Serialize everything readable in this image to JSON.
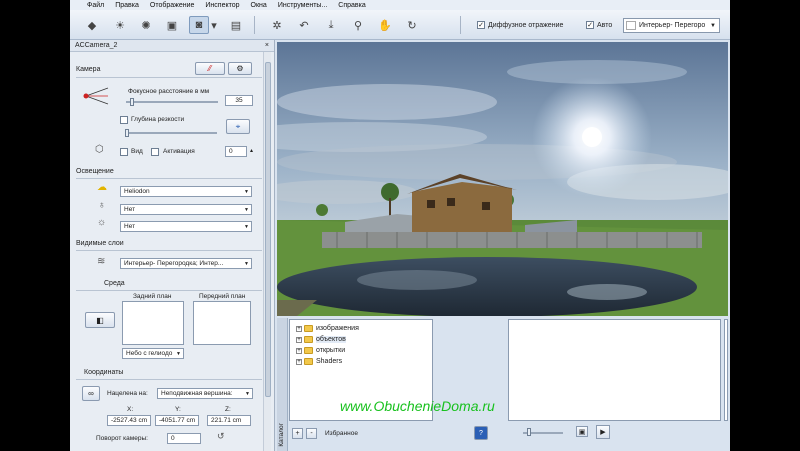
{
  "menu": [
    "Файл",
    "Правка",
    "Отображение",
    "Инспектор",
    "Окна",
    "Инструменты...",
    "Справка"
  ],
  "toolbar": {
    "diffuse_label": "Диффузное отражение",
    "diffuse_checked": "✓",
    "auto_label": "Авто",
    "auto_checked": "✓",
    "preset_value": "Интерьер- Перегоро"
  },
  "panel": {
    "title": "ACCamera_2",
    "close": "×",
    "camera": {
      "heading": "Камера",
      "focal_label": "Фокусное расстояние в мм",
      "focal_value": "35",
      "dof_label": "Глубина резкости",
      "view_label": "Вид",
      "activation_label": "Активация",
      "activation_value": "0"
    },
    "lighting": {
      "heading": "Освещение",
      "sun_value": "Heliodon",
      "light2_value": "Нет",
      "light3_value": "Нет"
    },
    "layers": {
      "heading": "Видимые слои",
      "value": "Интерьер- Перегородка; Интер..."
    },
    "environment": {
      "heading": "Среда",
      "back_label": "Задний план",
      "front_label": "Передний план",
      "sky_value": "Небо с гелиодо"
    },
    "coords": {
      "heading": "Координаты",
      "target_label": "Нацелена на:",
      "target_value": "Неподвижная вершина:",
      "x_label": "X:",
      "y_label": "Y:",
      "z_label": "Z:",
      "x_value": "-2527.43 cm",
      "y_value": "-4051.77 cm",
      "z_value": "221.71 cm",
      "rotation_label": "Поворот камеры:",
      "rotation_value": "0"
    }
  },
  "catalog": {
    "side_label": "Каталог",
    "tree": [
      "изображения",
      "объектов",
      "открытки",
      "Shaders"
    ],
    "favorites_label": "Избранное",
    "add": "+",
    "remove": "-"
  },
  "watermark": "www.ObuchenieDoma.ru"
}
